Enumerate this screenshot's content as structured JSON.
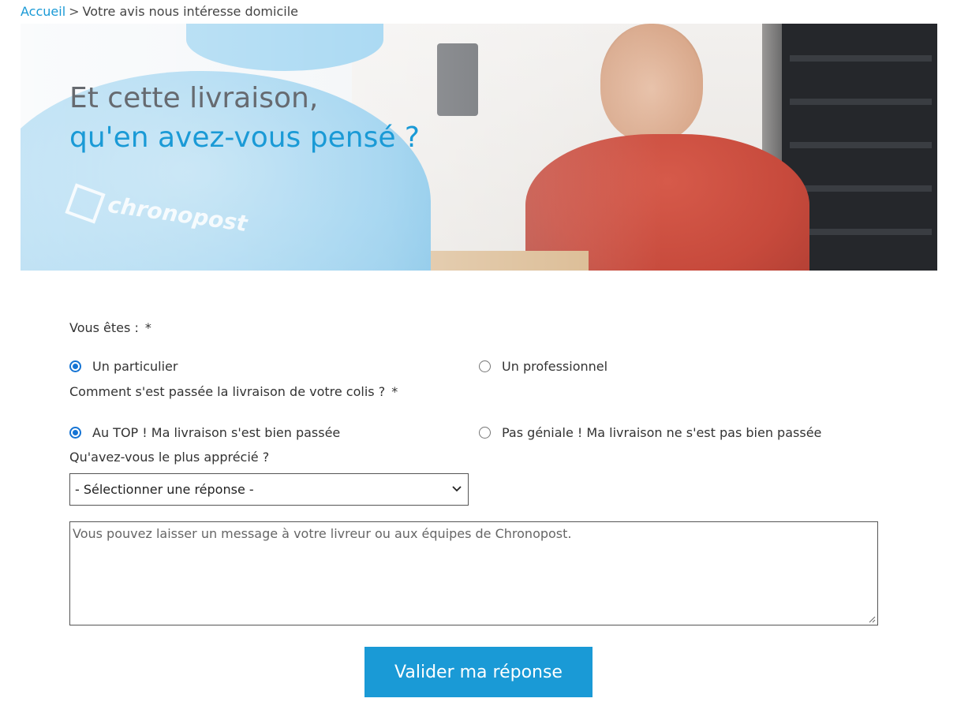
{
  "breadcrumb": {
    "home_label": "Accueil",
    "separator": ">",
    "current": "Votre avis nous intéresse domicile"
  },
  "hero": {
    "title_line1": "Et cette livraison,",
    "title_line2": "qu'en avez-vous pensé ?",
    "brand_text": "chronopost"
  },
  "form": {
    "q1": {
      "label": "Vous êtes :",
      "required": "*",
      "options": [
        {
          "label": "Un particulier",
          "checked": true
        },
        {
          "label": "Un professionnel",
          "checked": false
        }
      ]
    },
    "q2": {
      "label": "Comment s'est passée la livraison de votre colis ?",
      "required": "*",
      "options": [
        {
          "label": "Au TOP ! Ma livraison s'est bien passée",
          "checked": true
        },
        {
          "label": "Pas géniale ! Ma livraison ne s'est pas bien passée",
          "checked": false
        }
      ]
    },
    "q3": {
      "label": "Qu'avez-vous le plus apprécié ?",
      "select_value": "- Sélectionner une réponse -"
    },
    "message": {
      "placeholder": "Vous pouvez laisser un message à votre livreur ou aux équipes de Chronopost."
    },
    "submit_label": "Valider ma réponse"
  },
  "colors": {
    "accent": "#1a9ad6",
    "radio_checked": "#1574d4",
    "title_grey": "#666a70"
  }
}
